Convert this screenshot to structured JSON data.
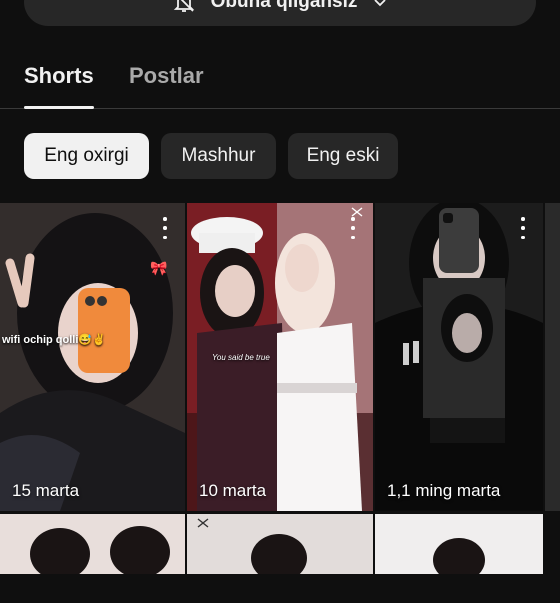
{
  "subscribe": {
    "label": "Obuna qilgansiz",
    "bell_icon": "bell-notifications-off-icon",
    "chevron_icon": "chevron-down-icon"
  },
  "tabs": [
    {
      "label": "Shorts",
      "active": true
    },
    {
      "label": "Postlar",
      "active": false
    }
  ],
  "filters": [
    {
      "label": "Eng oxirgi",
      "selected": true
    },
    {
      "label": "Mashhur",
      "selected": false
    },
    {
      "label": "Eng eski",
      "selected": false
    }
  ],
  "shorts": [
    {
      "views": "15 marta",
      "caption": "wifi ochip qolli😅✌️",
      "more_icon": "more-vertical-icon"
    },
    {
      "views": "10 marta",
      "caption": "You said be true",
      "more_icon": "more-vertical-icon"
    },
    {
      "views": "1,1 ming marta",
      "caption": "",
      "more_icon": "more-vertical-icon"
    }
  ],
  "colors": {
    "background": "#0f0f0f",
    "chip": "#272727",
    "chip_selected": "#f1f1f1",
    "text": "#f1f1f1",
    "muted": "#aaaaaa"
  }
}
